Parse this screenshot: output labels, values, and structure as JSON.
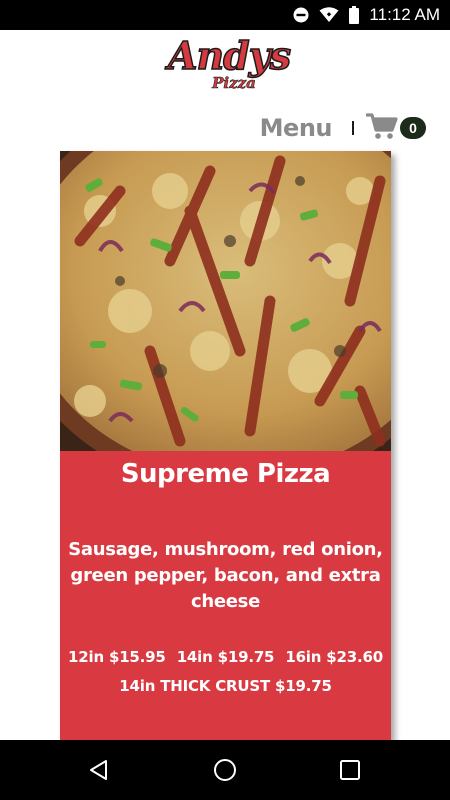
{
  "status_bar": {
    "time": "11:12 AM",
    "icons": [
      "do-not-disturb-icon",
      "wifi-icon",
      "battery-icon"
    ]
  },
  "logo": {
    "main": "Andys",
    "sub": "Pizza"
  },
  "nav": {
    "menu_label": "Menu",
    "cart_count": "0"
  },
  "product": {
    "name": "Supreme Pizza",
    "description": "Sausage, mushroom, red onion, green pepper, bacon, and extra cheese",
    "prices": {
      "p12": "12in $15.95",
      "p14": "14in $19.75",
      "p16": "16in $23.60",
      "thick": "14in THICK CRUST $19.75"
    }
  },
  "system_nav": {
    "buttons": [
      "back-icon",
      "home-icon",
      "recents-icon"
    ]
  },
  "colors": {
    "brand_red": "#d93a42",
    "menu_gray": "#8a8a8a",
    "badge_dark": "#1d2b1d"
  }
}
